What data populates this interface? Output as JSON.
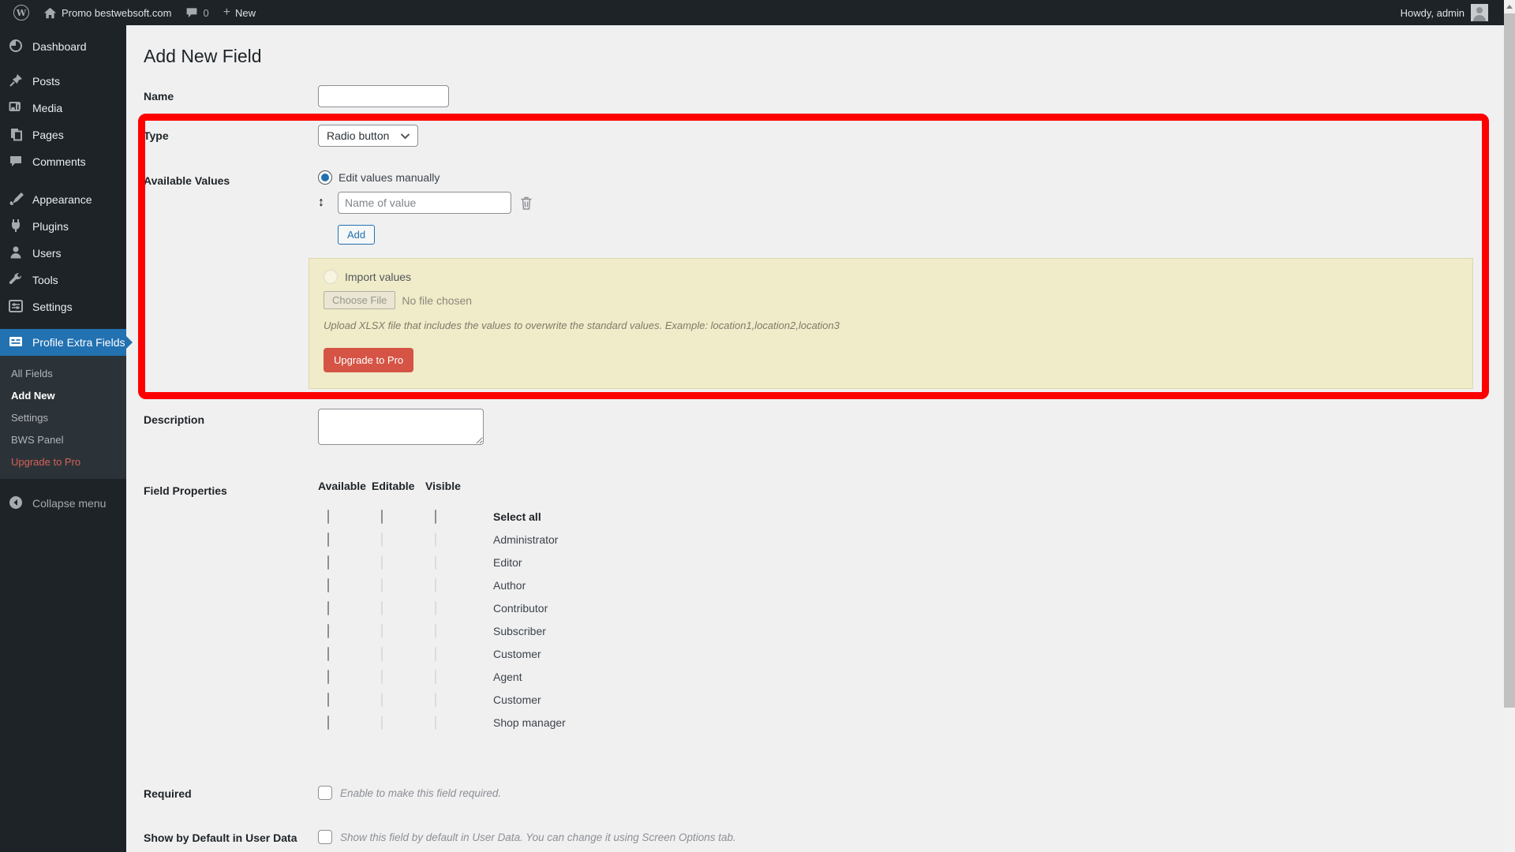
{
  "admin_bar": {
    "site_name": "Promo bestwebsoft.com",
    "comments_count": "0",
    "new_label": "New",
    "howdy": "Howdy, admin"
  },
  "sidebar": {
    "items": [
      {
        "label": "Dashboard",
        "icon": "dashboard-icon"
      },
      {
        "label": "Posts",
        "icon": "pushpin-icon"
      },
      {
        "label": "Media",
        "icon": "media-icon"
      },
      {
        "label": "Pages",
        "icon": "pages-icon"
      },
      {
        "label": "Comments",
        "icon": "comment-icon"
      },
      {
        "label": "Appearance",
        "icon": "brush-icon"
      },
      {
        "label": "Plugins",
        "icon": "plugin-icon"
      },
      {
        "label": "Users",
        "icon": "user-icon"
      },
      {
        "label": "Tools",
        "icon": "wrench-icon"
      },
      {
        "label": "Settings",
        "icon": "sliders-icon"
      },
      {
        "label": "Profile Extra Fields",
        "icon": "id-card-icon",
        "active": true
      }
    ],
    "submenu": {
      "all_fields": "All Fields",
      "add_new": "Add New",
      "settings": "Settings",
      "bws_panel": "BWS Panel",
      "upgrade": "Upgrade to Pro"
    },
    "collapse_label": "Collapse menu"
  },
  "page": {
    "title": "Add New Field",
    "name_label": "Name",
    "name_value": "",
    "type_label": "Type",
    "type_value": "Radio button",
    "available_values_label": "Available Values",
    "edit_values_manually": "Edit values manually",
    "value_placeholder": "Name of value",
    "add_button": "Add",
    "import_values": "Import values",
    "choose_file_button": "Choose File",
    "no_file_chosen": "No file chosen",
    "upload_hint": "Upload XLSX file that includes the values to overwrite the standard values. Example: location1,location2,location3",
    "upgrade_button": "Upgrade to Pro",
    "description_label": "Description",
    "description_value": "",
    "field_properties_label": "Field Properties",
    "columns": {
      "available": "Available",
      "editable": "Editable",
      "visible": "Visible"
    },
    "roles": [
      "Select all",
      "Administrator",
      "Editor",
      "Author",
      "Contributor",
      "Subscriber",
      "Customer",
      "Agent",
      "Customer",
      "Shop manager"
    ],
    "required_label": "Required",
    "required_hint": "Enable to make this field required.",
    "show_default_label": "Show by Default in User Data",
    "show_default_hint": "Show this field by default in User Data. You can change it using Screen Options tab."
  },
  "colors": {
    "accent_blue": "#2271b1",
    "sidebar_bg": "#1d2327",
    "annotation_red": "#fe0000",
    "notice_bg": "#f0ebc8",
    "upgrade_red": "#d55445",
    "content_bg": "#f0f0f1"
  }
}
